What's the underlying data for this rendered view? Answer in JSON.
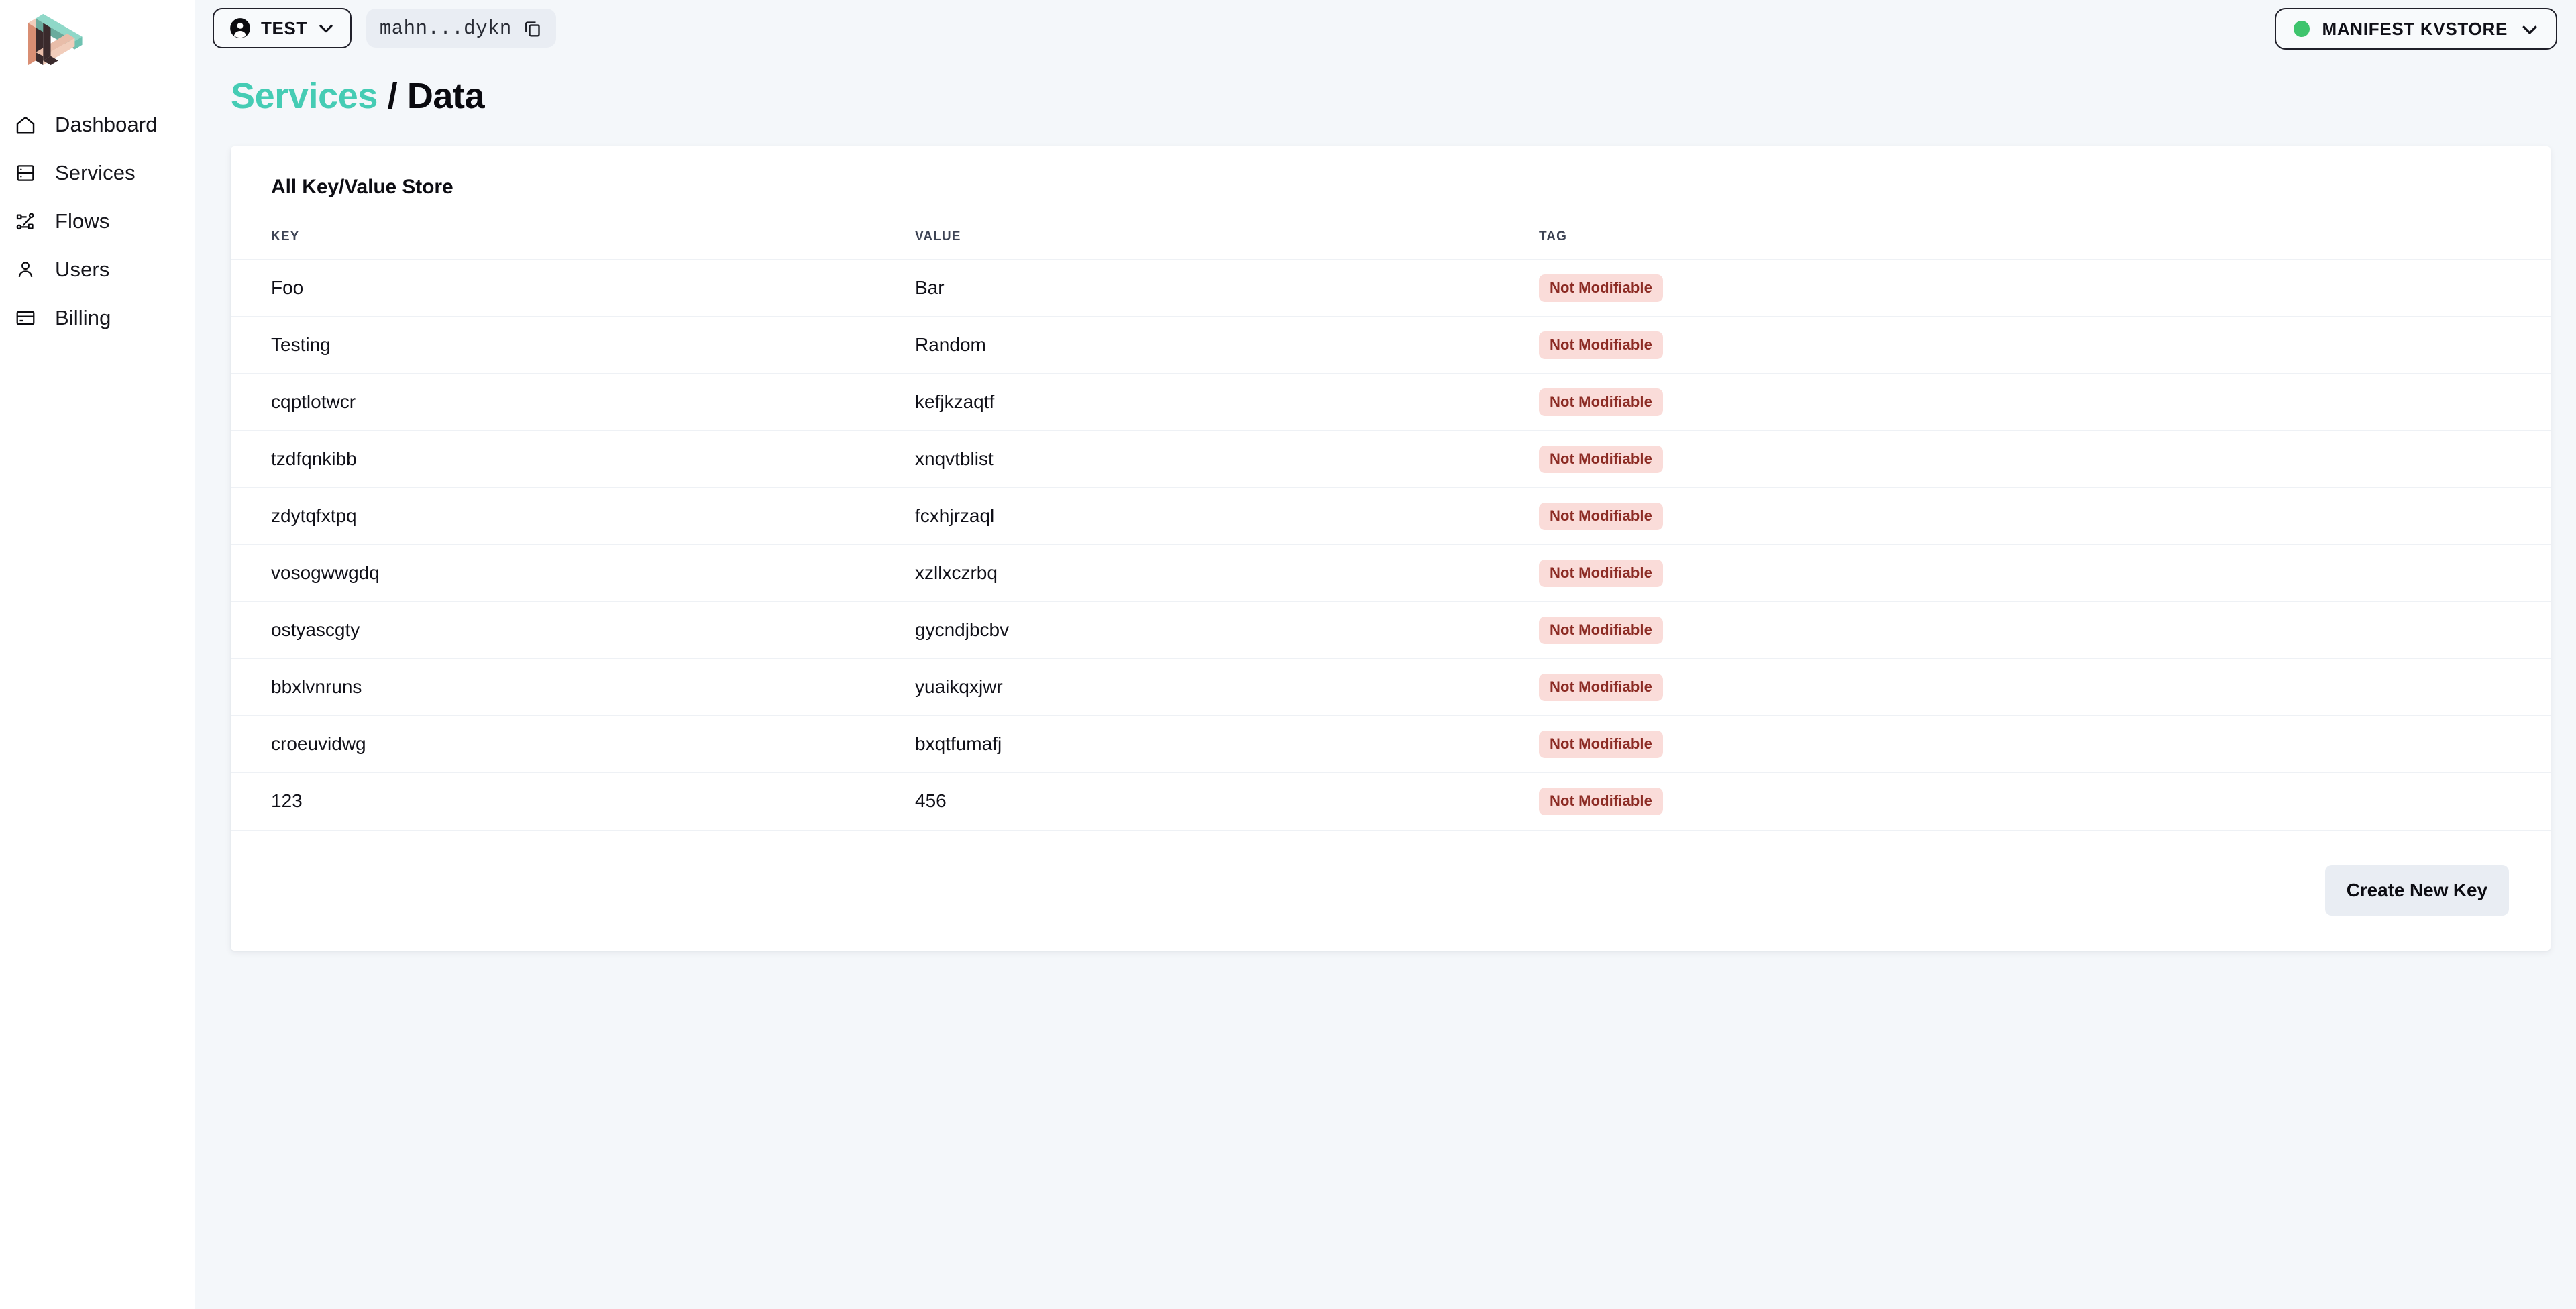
{
  "sidebar": {
    "logo_name": "penrose-triangle-logo",
    "logo_colors": {
      "salmon": "#dd9277",
      "peach": "#f1cdbb",
      "teal": "#7fccbe",
      "mint": "#8fd8c8",
      "dark": "#3a2a2c"
    },
    "items": [
      {
        "label": "Dashboard",
        "icon": "home-icon"
      },
      {
        "label": "Services",
        "icon": "server-icon"
      },
      {
        "label": "Flows",
        "icon": "flows-icon"
      },
      {
        "label": "Users",
        "icon": "user-icon"
      },
      {
        "label": "Billing",
        "icon": "credit-card-icon"
      }
    ]
  },
  "topbar": {
    "org_button_label": "TEST",
    "org_icon": "account-circle-icon",
    "account_id": "mahn...dykn",
    "copy_icon": "copy-icon",
    "kvstore_label": "MANIFEST KVSTORE",
    "kvstore_status_color": "#3ec46d",
    "chevron_icon": "chevron-down-icon"
  },
  "page": {
    "breadcrumb_parent": "Services",
    "breadcrumb_separator": "/",
    "breadcrumb_current": "Data",
    "accent_color": "#45ccb4"
  },
  "card": {
    "title": "All Key/Value Store",
    "columns": [
      "KEY",
      "VALUE",
      "TAG"
    ],
    "rows": [
      {
        "key": "Foo",
        "value": "Bar",
        "tag": "Not Modifiable"
      },
      {
        "key": "Testing",
        "value": "Random",
        "tag": "Not Modifiable"
      },
      {
        "key": "cqptlotwcr",
        "value": "kefjkzaqtf",
        "tag": "Not Modifiable"
      },
      {
        "key": "tzdfqnkibb",
        "value": "xnqvtblist",
        "tag": "Not Modifiable"
      },
      {
        "key": "zdytqfxtpq",
        "value": "fcxhjrzaql",
        "tag": "Not Modifiable"
      },
      {
        "key": "vosogwwgdq",
        "value": "xzllxczrbq",
        "tag": "Not Modifiable"
      },
      {
        "key": "ostyascgty",
        "value": "gycndjbcbv",
        "tag": "Not Modifiable"
      },
      {
        "key": "bbxlvnruns",
        "value": "yuaikqxjwr",
        "tag": "Not Modifiable"
      },
      {
        "key": "croeuvidwg",
        "value": "bxqtfumafj",
        "tag": "Not Modifiable"
      },
      {
        "key": "123",
        "value": "456",
        "tag": "Not Modifiable"
      }
    ],
    "tag_bg_color": "#fadcd9",
    "tag_text_color": "#8c2b24",
    "create_button_label": "Create New Key"
  }
}
